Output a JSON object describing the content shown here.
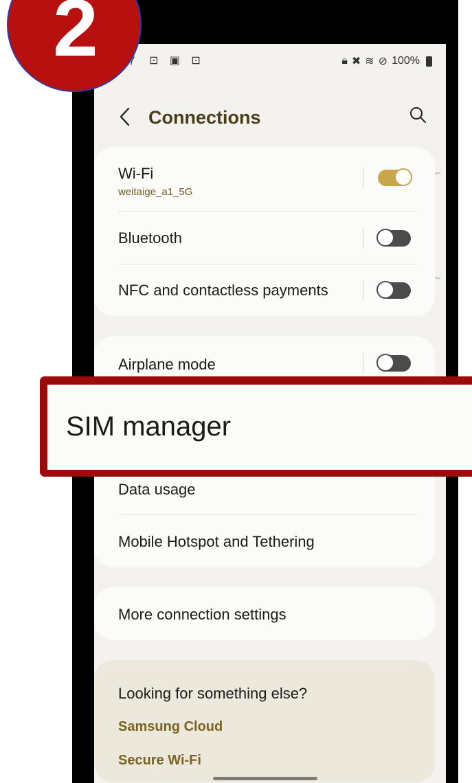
{
  "status_bar": {
    "time": "7",
    "left_icons": "⊡ ▣ ⊡",
    "battery": "100%"
  },
  "header": {
    "title": "Connections"
  },
  "sections": {
    "wifi": {
      "label": "Wi-Fi",
      "network": "weitaige_a1_5G",
      "enabled": true
    },
    "bluetooth": {
      "label": "Bluetooth",
      "enabled": false
    },
    "nfc": {
      "label": "NFC and contactless payments",
      "enabled": false
    },
    "airplane": {
      "label": "Airplane mode",
      "enabled": false
    },
    "data_usage": {
      "label": "Data usage"
    },
    "hotspot": {
      "label": "Mobile Hotspot and Tethering"
    },
    "more": {
      "label": "More connection settings"
    }
  },
  "suggestions": {
    "title": "Looking for something else?",
    "links": [
      "Samsung Cloud",
      "Secure Wi-Fi"
    ]
  },
  "callout": {
    "label": "SIM manager"
  },
  "step_badge": {
    "number": "2"
  },
  "colors": {
    "accent": "#c9a64a",
    "title": "#4a3d1e",
    "callout_border": "#9c0b0b",
    "badge": "#b80f0f"
  }
}
